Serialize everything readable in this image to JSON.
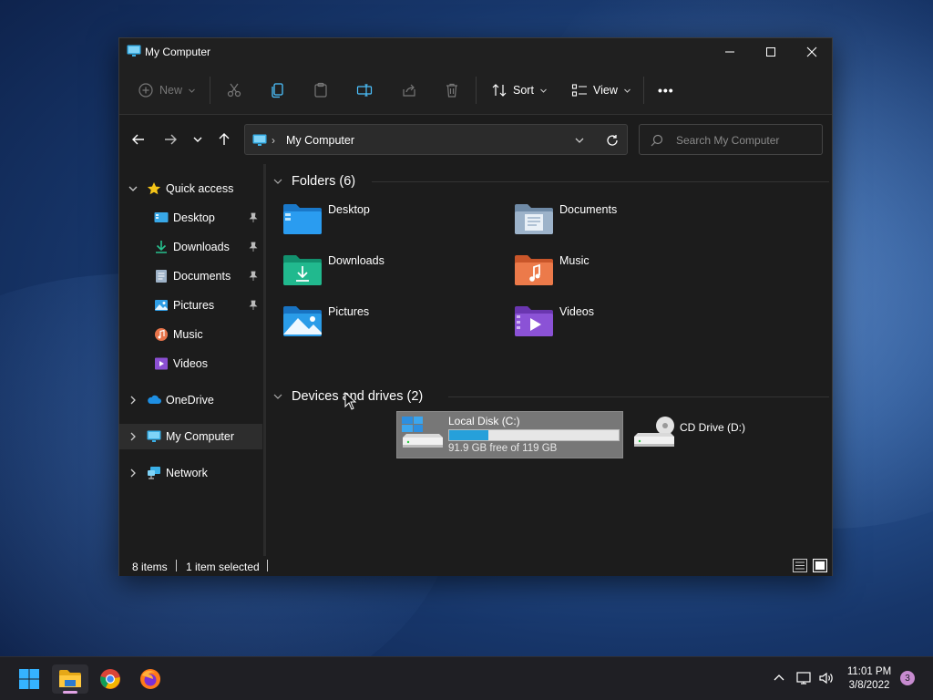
{
  "window": {
    "title": "My Computer",
    "controls": [
      "minimize",
      "maximize",
      "close"
    ]
  },
  "toolbar": {
    "new_label": "New",
    "sort_label": "Sort",
    "view_label": "View",
    "more_label": "•••",
    "icons": [
      "new-icon",
      "cut-icon",
      "copy-icon",
      "paste-icon",
      "rename-icon",
      "share-icon",
      "delete-icon",
      "sort-icon",
      "view-icon",
      "more-icon"
    ]
  },
  "address": {
    "path": "My Computer",
    "separator": "›"
  },
  "search": {
    "placeholder": "Search My Computer"
  },
  "sidebar": {
    "quick_access": "Quick access",
    "items": [
      {
        "label": "Desktop",
        "icon": "desktop-icon",
        "pinned": true
      },
      {
        "label": "Downloads",
        "icon": "downloads-icon",
        "pinned": true
      },
      {
        "label": "Documents",
        "icon": "documents-icon",
        "pinned": true
      },
      {
        "label": "Pictures",
        "icon": "pictures-icon",
        "pinned": true
      },
      {
        "label": "Music",
        "icon": "music-icon",
        "pinned": false
      },
      {
        "label": "Videos",
        "icon": "videos-icon",
        "pinned": false
      }
    ],
    "onedrive": "OneDrive",
    "my_computer": "My Computer",
    "network": "Network"
  },
  "content": {
    "folders_header": "Folders (6)",
    "folders": [
      {
        "name": "Desktop",
        "color": "#1e90e8"
      },
      {
        "name": "Documents",
        "color": "#8fa7c0"
      },
      {
        "name": "Downloads",
        "color": "#1fb58f"
      },
      {
        "name": "Music",
        "color": "#e8743a"
      },
      {
        "name": "Pictures",
        "color": "#2a9be0"
      },
      {
        "name": "Videos",
        "color": "#8a4fd0"
      }
    ],
    "drives_header": "Devices and drives (2)",
    "drives": [
      {
        "name": "Local Disk (C:)",
        "free_text": "91.9 GB free of 119 GB",
        "used_fraction": 0.23,
        "selected": true
      },
      {
        "name": "CD Drive (D:)",
        "selected": false
      }
    ]
  },
  "status": {
    "items": "8 items",
    "selected": "1 item selected",
    "divider": "|"
  },
  "taskbar": {
    "apps": [
      "start-icon",
      "file-explorer-icon",
      "chrome-icon",
      "firefox-icon"
    ],
    "time": "11:01 PM",
    "date": "3/8/2022",
    "notifications": "3"
  },
  "colors": {
    "accent": "#26a0da",
    "window_bg": "#1c1c1c",
    "taskbar_indicator": "#e1a3e5"
  }
}
